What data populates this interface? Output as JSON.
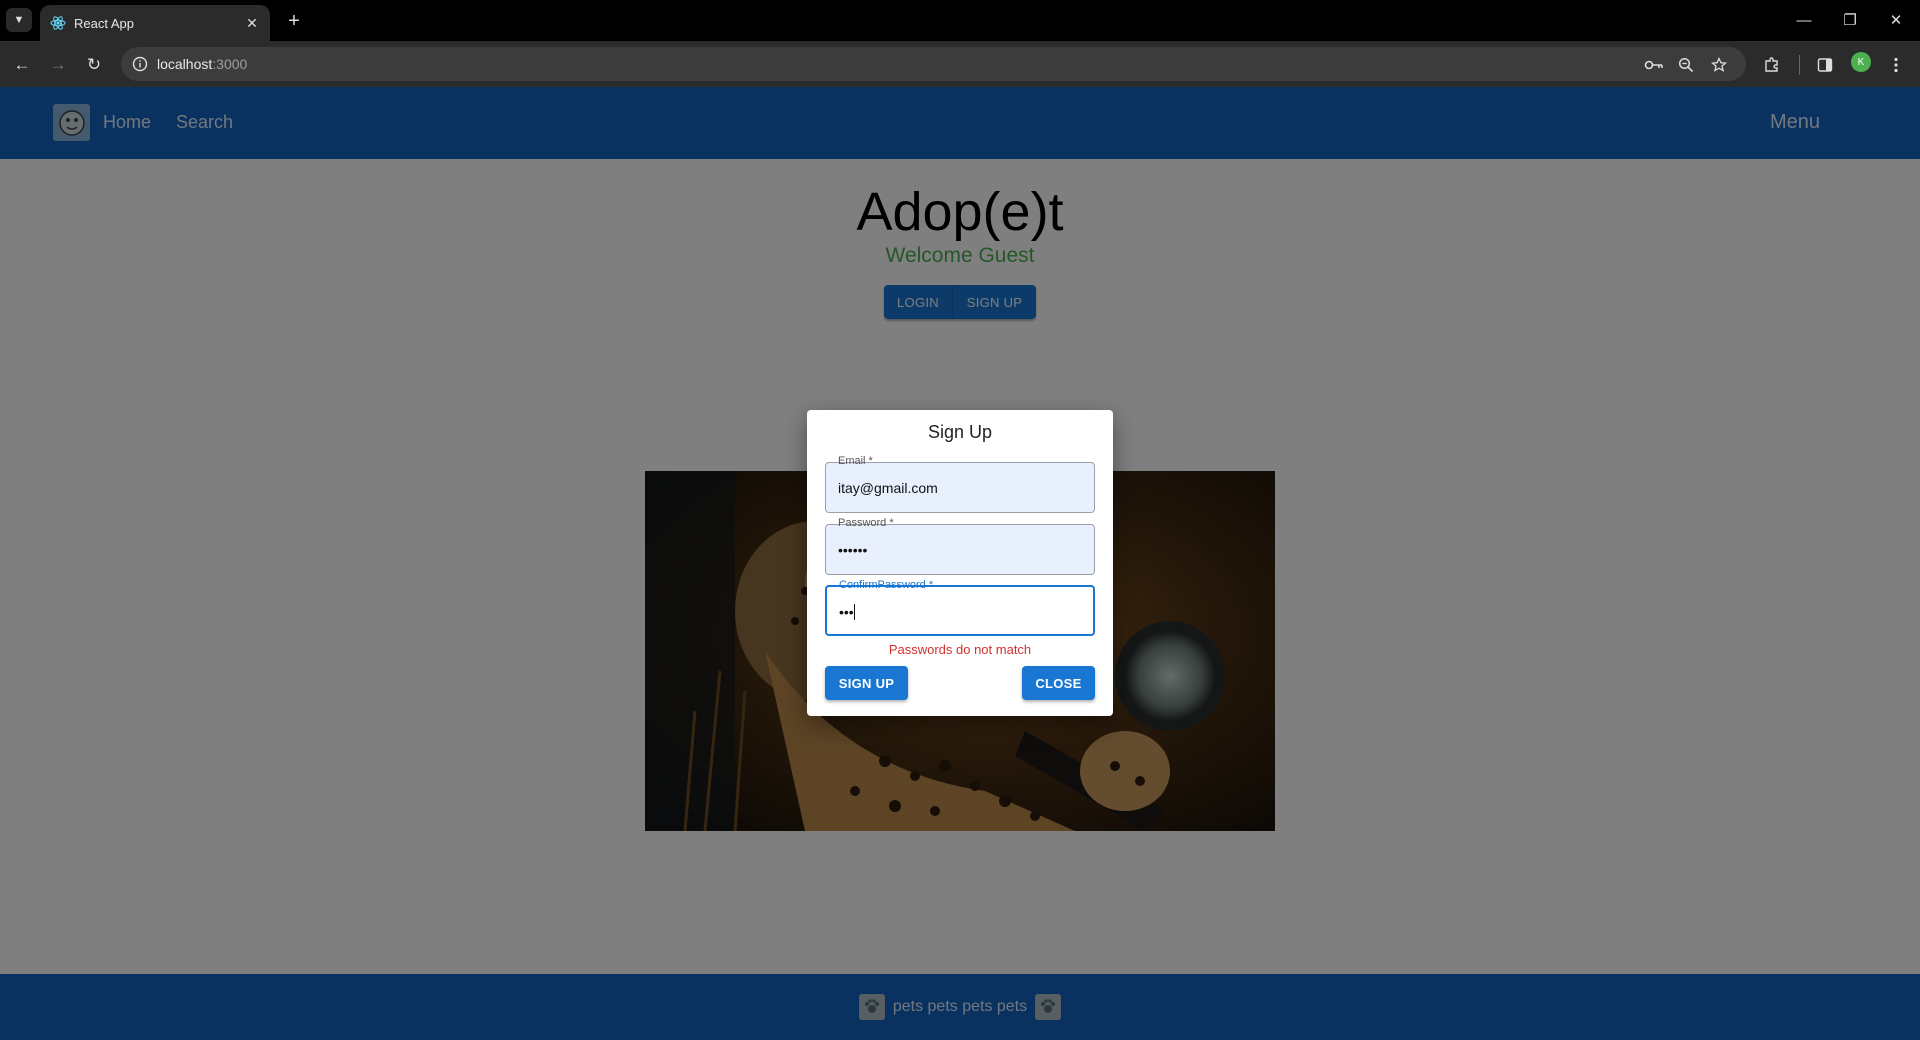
{
  "browser": {
    "tab_title": "React App",
    "url_host": "localhost",
    "url_port": ":3000",
    "profile_initial": "K"
  },
  "appbar": {
    "home_label": "Home",
    "search_label": "Search",
    "menu_label": "Menu"
  },
  "hero": {
    "title": "Adop(e)t",
    "welcome": "Welcome Guest",
    "login_label": "LOGIN",
    "signup_label": "SIGN UP"
  },
  "dialog": {
    "title": "Sign Up",
    "email_label": "Email *",
    "email_value": "itay@gmail.com",
    "password_label": "Password *",
    "password_value": "••••••",
    "confirm_label": "ConfirmPassword *",
    "confirm_value": "•••",
    "error": "Passwords do not match",
    "signup_button": "SIGN UP",
    "close_button": "CLOSE"
  },
  "footer": {
    "text": "pets pets pets pets"
  },
  "colors": {
    "primary": "#1565c0",
    "button": "#1976d2",
    "welcome": "#4caf50",
    "error": "#d32f2f"
  }
}
